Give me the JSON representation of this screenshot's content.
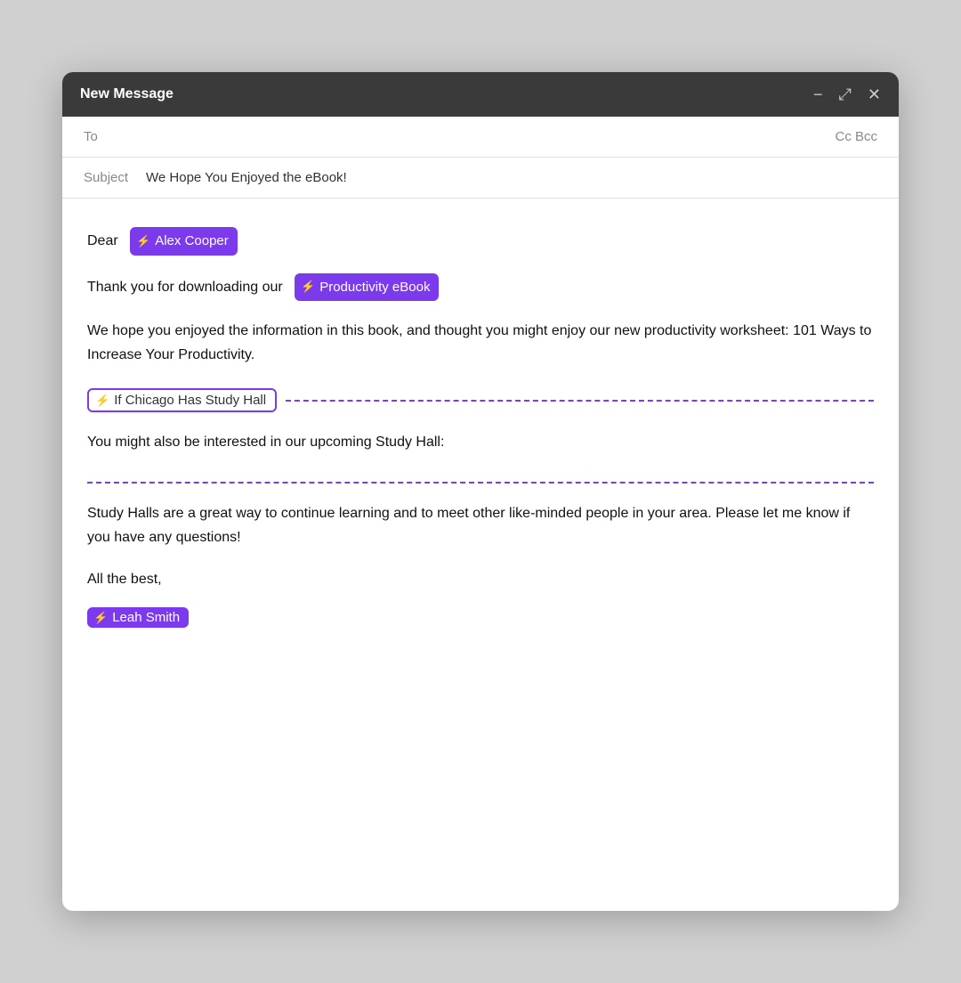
{
  "window": {
    "title": "New Message",
    "minimize_label": "−",
    "maximize_label": "⤢",
    "close_label": "✕"
  },
  "header": {
    "to_label": "To",
    "cc_bcc_label": "Cc Bcc",
    "subject_label": "Subject",
    "subject_value": "We Hope You Enjoyed the eBook!"
  },
  "body": {
    "dear_prefix": "Dear",
    "recipient_tag": "Alex Cooper",
    "line1_prefix": "Thank you for downloading our",
    "product_tag": "Productivity eBook",
    "paragraph1": "We hope you enjoyed the information in this book, and thought you might enjoy our new productivity worksheet: 101 Ways to Increase Your Productivity.",
    "conditional_tag": "If Chicago Has Study Hall",
    "line2": "You might also be interested in our upcoming Study Hall:",
    "paragraph2": "Study Halls are a great way to continue learning and to meet other like-minded people in your area. Please let me know if you have any questions!",
    "closing": "All the best,",
    "sender_tag": "Leah Smith"
  },
  "icons": {
    "lightning": "⚡"
  }
}
